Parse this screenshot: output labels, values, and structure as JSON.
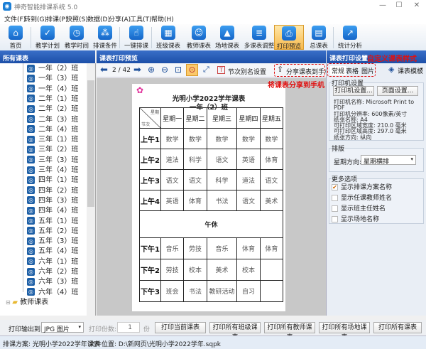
{
  "app": {
    "title": "神奇智能排课系统 5.0",
    "window_controls": [
      "—",
      "☐",
      "✕"
    ]
  },
  "menu": [
    "文件(F)",
    "转到(G)",
    "排课(P)",
    "快照(S)",
    "数据(D)",
    "分享(A)",
    "工具(T)",
    "帮助(H)"
  ],
  "toolbar": [
    {
      "label": "首页",
      "icon": "home-icon",
      "glyph": "⌂"
    },
    {
      "label": "教学计划",
      "icon": "clipboard-icon",
      "glyph": "✓"
    },
    {
      "label": "教学时间",
      "icon": "clock-icon",
      "glyph": "◷"
    },
    {
      "label": "排课条件",
      "icon": "cubes-icon",
      "glyph": "⁂"
    },
    {
      "label": "一键排课",
      "icon": "pointer-icon",
      "glyph": "☝"
    },
    {
      "label": "班级课表",
      "icon": "calendar-grid-icon",
      "glyph": "▦"
    },
    {
      "label": "教师课表",
      "icon": "teacher-icon",
      "glyph": "☺"
    },
    {
      "label": "场地课表",
      "icon": "building-icon",
      "glyph": "▲"
    },
    {
      "label": "多课表调整",
      "icon": "doc-settings-icon",
      "glyph": "≣"
    },
    {
      "label": "打印预览",
      "icon": "printer-icon",
      "glyph": "⎙",
      "active": true
    },
    {
      "label": "总课表",
      "icon": "calendar-icon",
      "glyph": "▤"
    },
    {
      "label": "统计分析",
      "icon": "chart-icon",
      "glyph": "↗"
    }
  ],
  "panels": {
    "left_title": "所有课表",
    "center_title": "课表打印预览",
    "right_title": "课表打印设置"
  },
  "annotations": {
    "custom_style": "自定义课表样式",
    "share_phone": "将课表分享到手机"
  },
  "tree": {
    "classes": [
      "一年（2）班",
      "一年（3）班",
      "一年（4）班",
      "二年（1）班",
      "二年（2）班",
      "二年（3）班",
      "二年（4）班",
      "三年（1）班",
      "三年（2）班",
      "三年（3）班",
      "三年（4）班",
      "四年（1）班",
      "四年（2）班",
      "四年（3）班",
      "四年（4）班",
      "五年（1）班",
      "五年（2）班",
      "五年（3）班",
      "五年（4）班",
      "六年（1）班",
      "六年（2）班",
      "六年（3）班",
      "六年（4）班"
    ],
    "folder": "教师课表"
  },
  "preview_toolbar": {
    "page": "2 / 42",
    "alias_label": "节次别名设置",
    "share_label": "分享课表到手机"
  },
  "timetable": {
    "school_title": "光明小学2022学年课表",
    "class_title": "一年（2）班",
    "corner_top": "星期",
    "corner_bottom": "节次",
    "days": [
      "星期一",
      "星期二",
      "星期三",
      "星期四",
      "星期五"
    ],
    "morning": [
      {
        "period": "上午1",
        "subjects": [
          "数学",
          "数学",
          "数学",
          "数学",
          "数学"
        ]
      },
      {
        "period": "上午2",
        "subjects": [
          "道法",
          "科学",
          "语文",
          "英语",
          "体育"
        ]
      },
      {
        "period": "上午3",
        "subjects": [
          "语文",
          "语文",
          "科学",
          "道法",
          "语文"
        ]
      },
      {
        "period": "上午4",
        "subjects": [
          "英语",
          "体育",
          "书法",
          "语文",
          "美术"
        ]
      }
    ],
    "break": "午休",
    "afternoon": [
      {
        "period": "下午1",
        "subjects": [
          "音乐",
          "劳技",
          "音乐",
          "体育",
          "体育"
        ]
      },
      {
        "period": "下午2",
        "subjects": [
          "劳技",
          "校本",
          "美术",
          "校本",
          ""
        ]
      },
      {
        "period": "下午3",
        "subjects": [
          "班会",
          "书法",
          "教研活动",
          "自习",
          ""
        ]
      }
    ]
  },
  "settings": {
    "tabs": [
      "常规",
      "表格",
      "图片"
    ],
    "template_label": "课表模板",
    "printer_group": "打印机设置",
    "printer_btn": "打印机设置...",
    "page_btn": "页面设置...",
    "info": [
      "打印机名称: Microsoft Print to PDF",
      "打印机分辨率: 600像素/英寸",
      "纸张名称: A4",
      "可打印区域宽度: 210.0 毫米",
      "可打印区域高度: 297.0 毫米",
      "纸张方向: 纵向"
    ],
    "layout_group": "排版",
    "week_dir_label": "星期方向:",
    "week_dir_value": "星期横排",
    "more_group": "更多选项",
    "options": [
      {
        "label": "显示排课方案名称",
        "checked": true
      },
      {
        "label": "显示任课教师姓名",
        "checked": false
      },
      {
        "label": "显示班主任姓名",
        "checked": false
      },
      {
        "label": "显示场地名称",
        "checked": false
      }
    ]
  },
  "bottom": {
    "output_label": "打印输出到:",
    "output_value": "JPG 图片",
    "copies_label": "打印份数:",
    "copies_value": "1",
    "copies_unit": "份",
    "buttons": [
      "打印当前课表",
      "打印所有班级课表",
      "打印所有教师课表",
      "打印所有场地课表",
      "打印所有课表"
    ]
  },
  "status": {
    "plan": "排课方案: 光明小学2022学年课表",
    "file": "文件位置: D:\\新网页\\光明小学2022学年.sqpk"
  }
}
